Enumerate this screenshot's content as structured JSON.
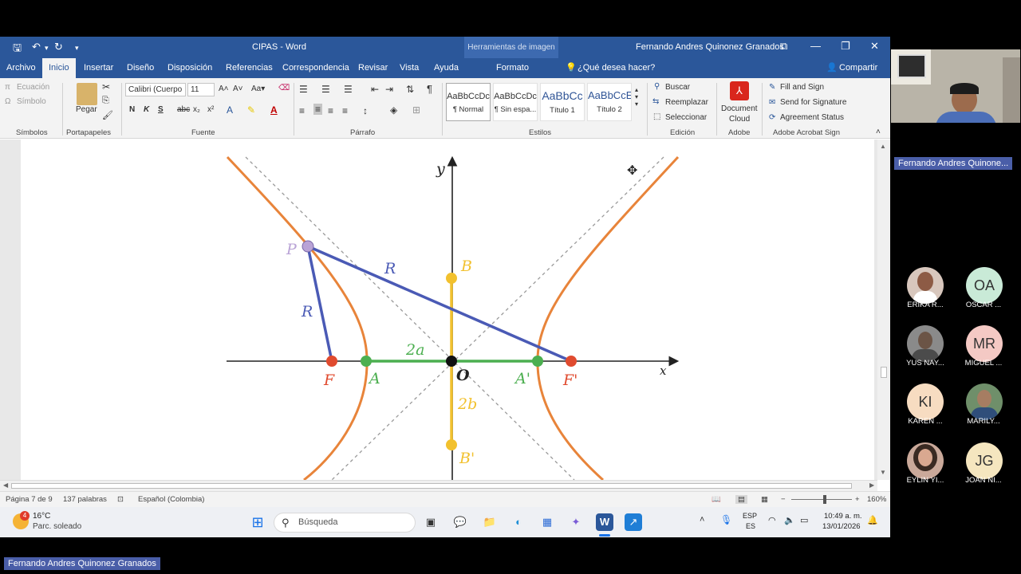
{
  "window": {
    "title": "CIPAS  -  Word",
    "context_tab": "Herramientas de imagen",
    "user": "Fernando Andres Quinonez Granados"
  },
  "tabs": [
    {
      "label": "Archivo"
    },
    {
      "label": "Inicio"
    },
    {
      "label": "Insertar"
    },
    {
      "label": "Diseño"
    },
    {
      "label": "Disposición"
    },
    {
      "label": "Referencias"
    },
    {
      "label": "Correspondencia"
    },
    {
      "label": "Revisar"
    },
    {
      "label": "Vista"
    },
    {
      "label": "Ayuda"
    },
    {
      "label": "Formato"
    }
  ],
  "tell_me": "¿Qué desea hacer?",
  "share": "Compartir",
  "ribbon": {
    "symbols": {
      "ecuacion": "Ecuación",
      "simbolo": "Símbolo",
      "label": "Símbolos"
    },
    "clipboard": {
      "paste": "Pegar",
      "label": "Portapapeles"
    },
    "font": {
      "name": "Calibri (Cuerpo",
      "size": "11",
      "bold": "N",
      "italic": "K",
      "underline": "S",
      "strike": "abc",
      "sub": "x₂",
      "sup": "x²",
      "label": "Fuente"
    },
    "paragraph": {
      "label": "Párrafo"
    },
    "styles": {
      "items": [
        {
          "preview": "AaBbCcDc",
          "name": "¶ Normal"
        },
        {
          "preview": "AaBbCcDc",
          "name": "¶ Sin espa..."
        },
        {
          "preview": "AaBbCc",
          "name": "Título 1"
        },
        {
          "preview": "AaBbCcE",
          "name": "Título 2"
        }
      ],
      "label": "Estilos"
    },
    "editing": {
      "find": "Buscar",
      "replace": "Reemplazar",
      "select": "Seleccionar",
      "label": "Edición"
    },
    "adobe": {
      "doc_cloud_1": "Document",
      "doc_cloud_2": "Cloud",
      "label": "Adobe"
    },
    "acrobat": {
      "fill_sign": "Fill and Sign",
      "send_sig": "Send for Signature",
      "agreement": "Agreement Status",
      "label": "Adobe Acrobat Sign"
    }
  },
  "figure": {
    "axis_x": "x",
    "axis_y": "y",
    "P": "P",
    "R1": "R",
    "R2": "R",
    "B": "B",
    "B2": "B'",
    "two_a": "2a",
    "two_b": "2b",
    "F": "F",
    "A": "A",
    "O": "O",
    "A2": "A'",
    "F2": "F'"
  },
  "status": {
    "page": "Página 7 de 9",
    "words": "137 palabras",
    "language": "Español (Colombia)",
    "zoom": "160%"
  },
  "taskbar": {
    "temp": "16°C",
    "weather": "Parc. soleado",
    "weather_badge": "4",
    "search": "Búsqueda",
    "lang1": "ESP",
    "lang2": "ES",
    "time": "10:49 a. m.",
    "date": "13/01/2026"
  },
  "meeting": {
    "speaker_tag": "Fernando Andres Quinone...",
    "presenter_tag": "Fernando Andres Quinonez Granados",
    "participants": [
      {
        "initials": "",
        "name": "ERIKA R...",
        "color": "#d8c7bd"
      },
      {
        "initials": "OA",
        "name": "OSCAR ...",
        "color": "#c9ead7"
      },
      {
        "initials": "",
        "name": "YUS NAY...",
        "color": "#8a8a8a"
      },
      {
        "initials": "MR",
        "name": "MIGUEL ...",
        "color": "#f4c9c4"
      },
      {
        "initials": "KI",
        "name": "KAREN ...",
        "color": "#f7dcc1"
      },
      {
        "initials": "",
        "name": "MARILY...",
        "color": "#6f8f6a"
      },
      {
        "initials": "",
        "name": "EYLIN YI...",
        "color": "#caa99a"
      },
      {
        "initials": "JG",
        "name": "JOAN NI...",
        "color": "#f5e6bf"
      }
    ]
  }
}
